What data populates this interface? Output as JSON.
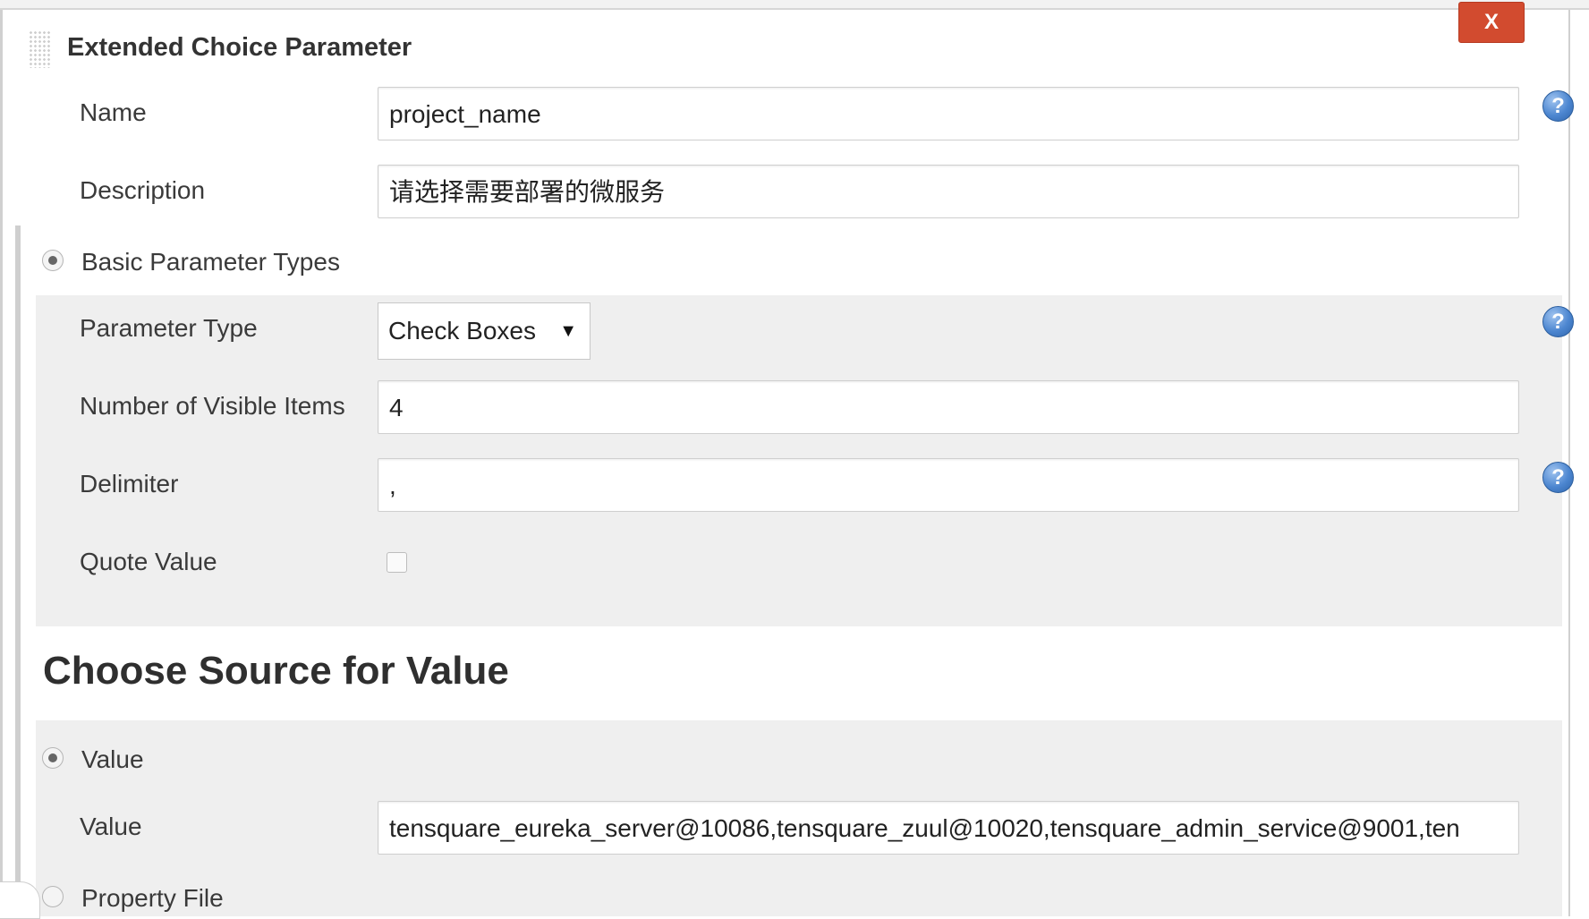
{
  "block": {
    "title": "Extended Choice Parameter",
    "close_label": "X"
  },
  "fields": {
    "name": {
      "label": "Name",
      "value": "project_name"
    },
    "description": {
      "label": "Description",
      "value": "请选择需要部署的微服务"
    }
  },
  "basic": {
    "radio_label": "Basic Parameter Types",
    "parameter_type": {
      "label": "Parameter Type",
      "value": "Check Boxes"
    },
    "visible_items": {
      "label": "Number of Visible Items",
      "value": "4"
    },
    "delimiter": {
      "label": "Delimiter",
      "value": ","
    },
    "quote_value": {
      "label": "Quote Value",
      "checked": false
    }
  },
  "source": {
    "heading": "Choose Source for Value",
    "value_radio_label": "Value",
    "value_field": {
      "label": "Value",
      "value": "tensquare_eureka_server@10086,tensquare_zuul@10020,tensquare_admin_service@9001,ten"
    },
    "property_file_label": "Property File"
  },
  "help_icon": {
    "glyph": "?"
  },
  "select_arrow": "▼",
  "colors": {
    "close_button": "#d24b2f",
    "help_icon": "#4c86d0",
    "section_bg": "#efefef"
  }
}
